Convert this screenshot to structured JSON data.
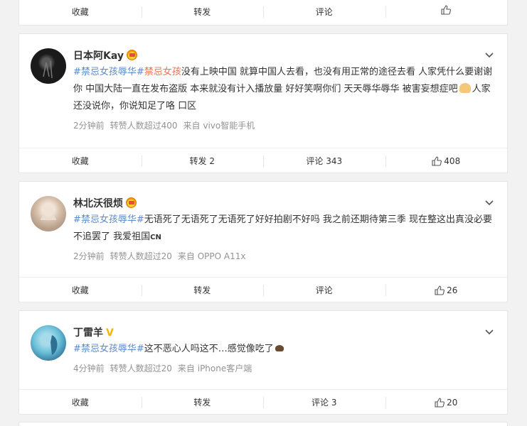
{
  "posts": [
    {
      "footer": {
        "collect": "收藏",
        "repost": "转发",
        "comment": "评论",
        "like": ""
      }
    },
    {
      "user": "日本阿Kay",
      "badge": "crown",
      "text_topic1": "#禁忌女孩辱华#",
      "text_topic2": "禁忌女孩",
      "text_body": "没有上映中国 就算中国人去看，也没有用正常的途径去看 人家凭什么要谢谢你 中国大陆一直在发布盗版 本来就没有计入播放量 好好笑啊你们 天天辱华辱华 被害妄想症吧",
      "text_tail": "人家还没说你，你说知足了咯 口区",
      "time": "2分钟前",
      "reposts_note": "转赞人数超过400",
      "source": "来自 vivo智能手机",
      "footer": {
        "collect": "收藏",
        "repost": "转发 2",
        "comment": "评论 343",
        "like": "408"
      }
    },
    {
      "user": "林北沃很烦",
      "badge": "crown",
      "text_topic1": "#禁忌女孩辱华#",
      "text_body": "无语死了无语死了无语死了好好拍剧不好吗 我之前还期待第三季 现在整这出真没必要不追罢了 我爱祖国",
      "text_flag": "CN",
      "time": "2分钟前",
      "reposts_note": "转赞人数超过20",
      "source": "来自 OPPO A11x",
      "footer": {
        "collect": "收藏",
        "repost": "转发",
        "comment": "评论",
        "like": "26"
      }
    },
    {
      "user": "丁雷羊",
      "badge": "V",
      "text_topic1": "#禁忌女孩辱华#",
      "text_body": "这不恶心人吗这不…感觉像吃了",
      "time": "4分钟前",
      "reposts_note": "转赞人数超过20",
      "source": "来自 iPhone客户端",
      "footer": {
        "collect": "收藏",
        "repost": "转发",
        "comment": "评论 3",
        "like": "20"
      }
    }
  ],
  "colors": {
    "topic": "#eb7350",
    "meta": "#939393",
    "vip": "#f7b500"
  },
  "icons": {
    "like": "thumbs-up-icon",
    "more": "chevron-down-icon"
  }
}
